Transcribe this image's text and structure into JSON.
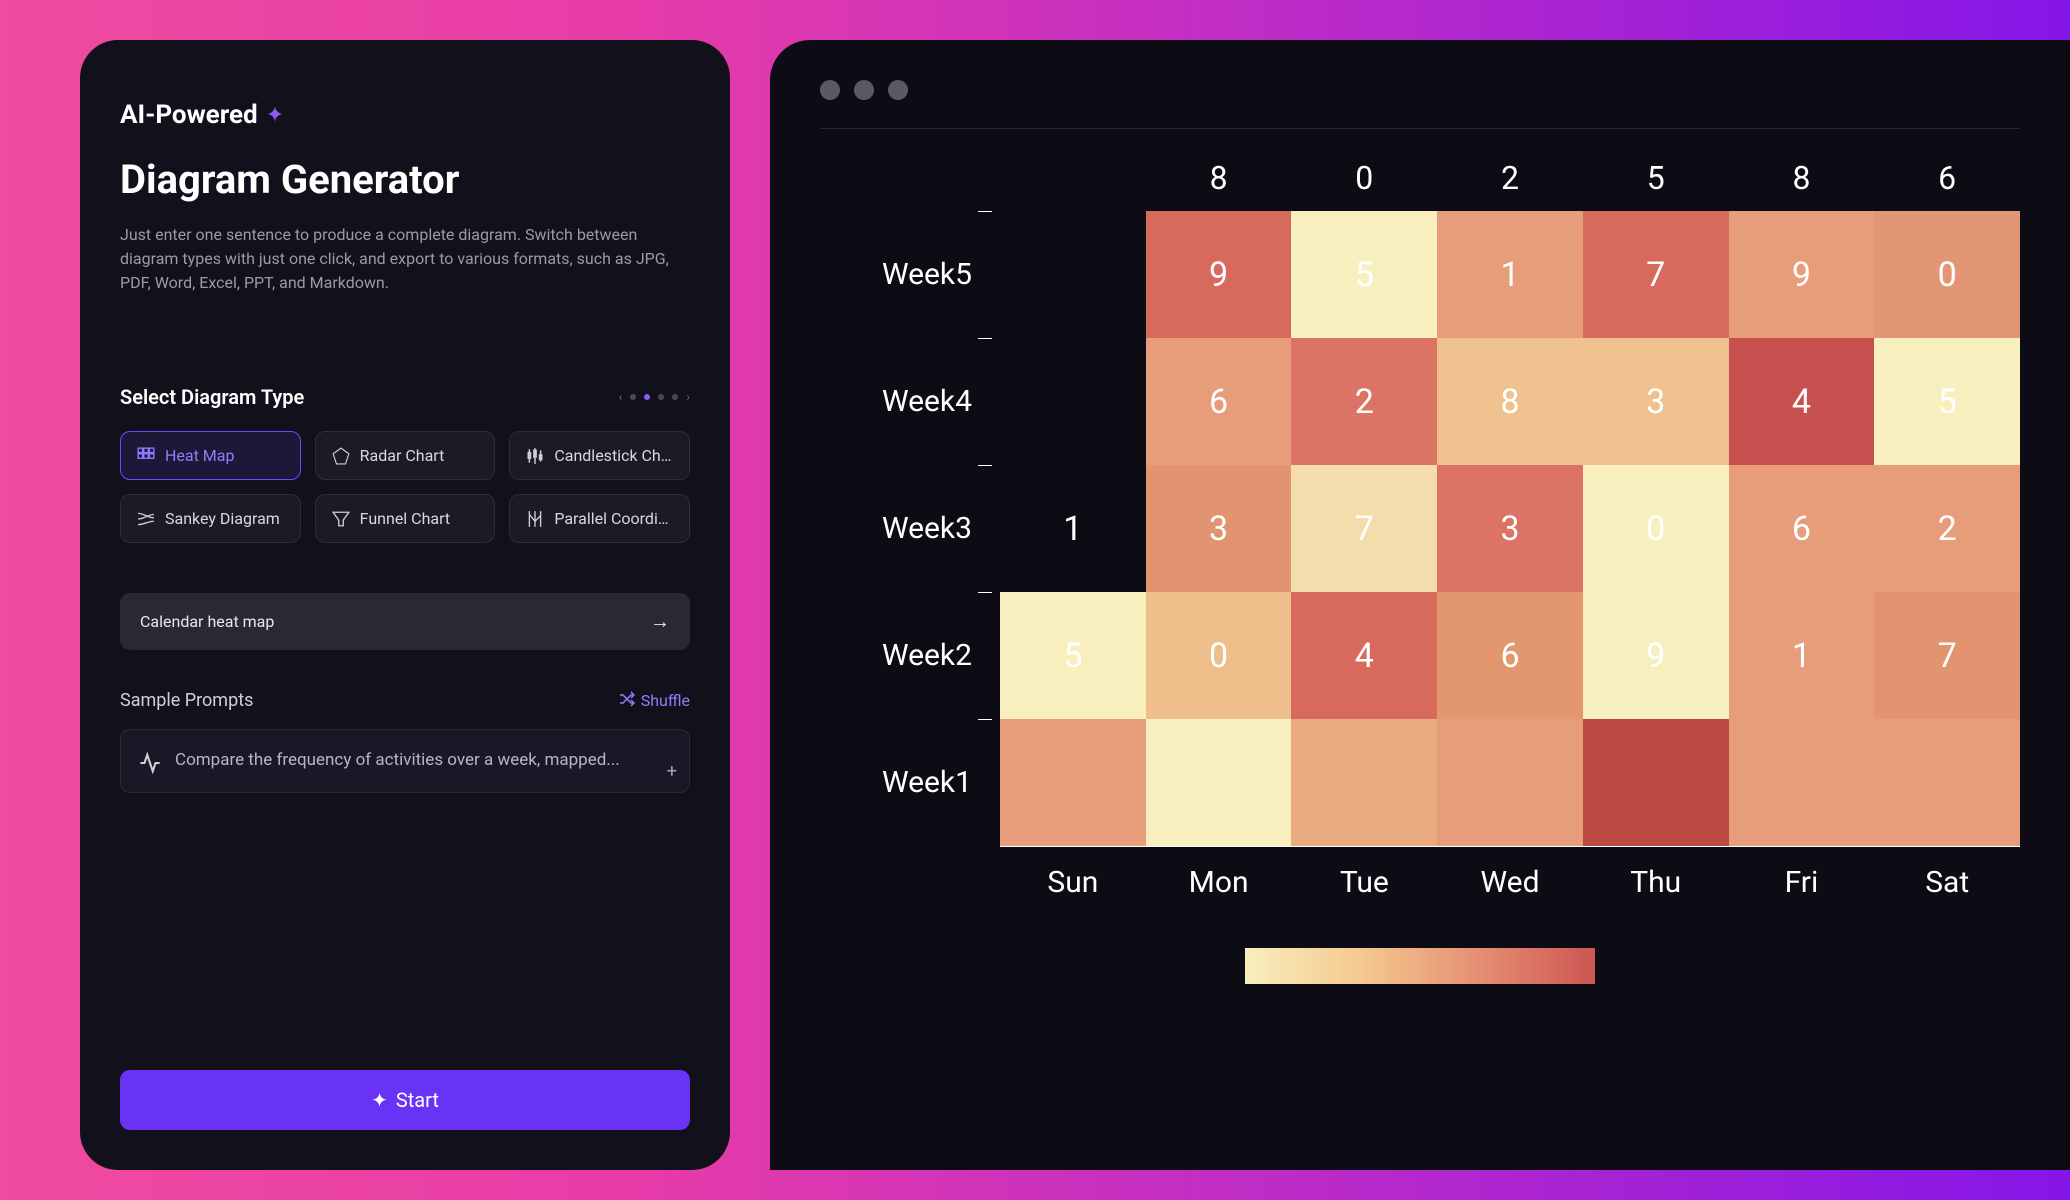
{
  "brand": {
    "label": "AI-Powered"
  },
  "title": "Diagram Generator",
  "description": "Just enter one sentence to produce a complete diagram. Switch between diagram types with just one click, and export to various formats, such as JPG, PDF, Word, Excel, PPT, and Markdown.",
  "diagram_type": {
    "label": "Select Diagram Type",
    "options": [
      {
        "id": "heatmap",
        "label": "Heat Map",
        "selected": true
      },
      {
        "id": "radar",
        "label": "Radar Chart",
        "selected": false
      },
      {
        "id": "candlestick",
        "label": "Candlestick Chart",
        "selected": false
      },
      {
        "id": "sankey",
        "label": "Sankey Diagram",
        "selected": false
      },
      {
        "id": "funnel",
        "label": "Funnel Chart",
        "selected": false
      },
      {
        "id": "parallel",
        "label": "Parallel Coordin...",
        "selected": false
      }
    ],
    "page_active": 1
  },
  "prompt_input": {
    "value": "Calendar heat map"
  },
  "sample": {
    "label": "Sample Prompts",
    "shuffle": "Shuffle",
    "card_text": "Compare the frequency of activities over a week, mapped..."
  },
  "start_label": "Start",
  "colors": {
    "accent": "#6833f5",
    "heat_low": "#f8efbe",
    "heat_high": "#cd5552"
  },
  "chart_data": {
    "type": "heatmap",
    "x_categories": [
      "Sun",
      "Mon",
      "Tue",
      "Wed",
      "Thu",
      "Fri",
      "Sat"
    ],
    "y_categories": [
      "Week5",
      "Week4",
      "Week3",
      "Week2",
      "Week1"
    ],
    "top_axis_values": [
      8,
      0,
      2,
      5,
      8,
      6
    ],
    "cells": [
      {
        "row": "Week5",
        "sun": null,
        "mon": 9,
        "tue": 5,
        "wed": 1,
        "thu": 7,
        "fri": 9,
        "sat": 0
      },
      {
        "row": "Week4",
        "sun": null,
        "mon": 6,
        "tue": 2,
        "wed": 8,
        "thu": 3,
        "fri": 4,
        "sat": 5
      },
      {
        "row": "Week3",
        "sun": 1,
        "mon": 3,
        "tue": 7,
        "wed": 3,
        "thu": 0,
        "fri": 6,
        "sat": 2
      },
      {
        "row": "Week2",
        "sun": 5,
        "mon": 0,
        "tue": 4,
        "wed": 6,
        "thu": 9,
        "fri": 1,
        "sat": 7
      },
      {
        "row": "Week1",
        "sun": null,
        "mon": null,
        "tue": null,
        "wed": null,
        "thu": null,
        "fri": null,
        "sat": null
      }
    ],
    "cell_colors": [
      [
        null,
        "#d86a5d",
        "#f8efbe",
        "#e79d7a",
        "#d86a5d",
        "#e79d7a",
        "#e39676"
      ],
      [
        null,
        "#e79d7a",
        "#db7464",
        "#efc18e",
        "#efc18e",
        "#c74f4d",
        "#f8efbe"
      ],
      [
        "#0d0b13",
        "#e1946f",
        "#f4ddac",
        "#db7464",
        "#f8efbe",
        "#e79d7a",
        "#e79d7a"
      ],
      [
        "#f8efbe",
        "#eebf8b",
        "#d86a5d",
        "#e2976f",
        "#f8efbe",
        "#e79d7a",
        "#e1946f"
      ],
      [
        "#e79d7a",
        "#f8efbe",
        "#e9ab7f",
        "#e79d7a",
        "#bc4844",
        "#e79d7a",
        "#e79d7a"
      ]
    ]
  }
}
